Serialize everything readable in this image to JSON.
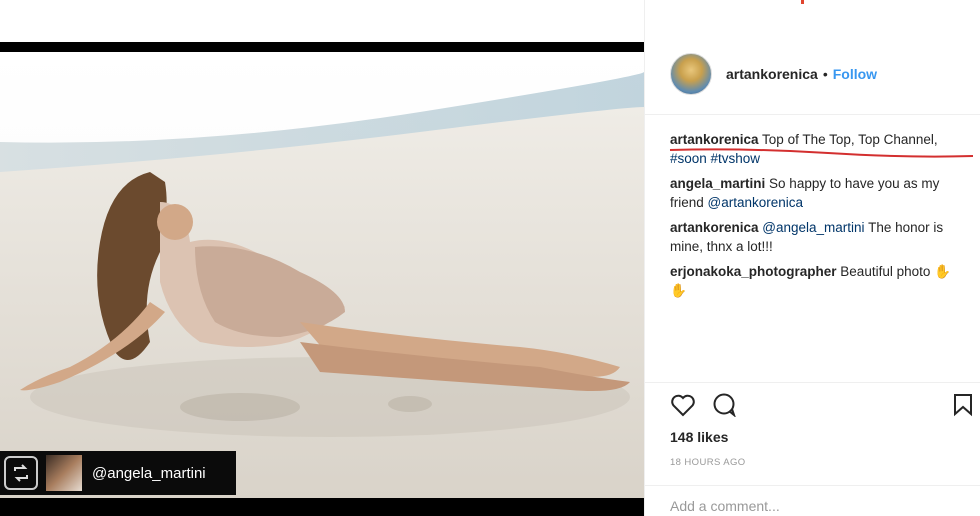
{
  "post": {
    "author": "artankorenica",
    "follow_label": "Follow",
    "separator": "•",
    "repost_credit": "@angela_martini"
  },
  "comments": [
    {
      "user": "artankorenica",
      "text": " Top of The Top, Top Channel, ",
      "tags": "#soon #tvshow"
    },
    {
      "user": "angela_martini",
      "text": " So happy to have you as my friend ",
      "tag": "@artankorenica"
    },
    {
      "user": "artankorenica",
      "tag": " @angela_martini",
      "text": " The honor is mine, thnx a lot!!!"
    },
    {
      "user": "erjonakoka_photographer",
      "text": " Beautiful photo ✋",
      "tail": "✋"
    }
  ],
  "likes": "148 likes",
  "timestamp": "18 HOURS AGO",
  "add_comment_placeholder": "Add a comment...",
  "icons": [
    "heart-icon",
    "comment-icon",
    "bookmark-icon",
    "repost-icon"
  ],
  "colors": {
    "follow": "#3897f0",
    "tag": "#003569",
    "underline": "#d32f2f"
  }
}
